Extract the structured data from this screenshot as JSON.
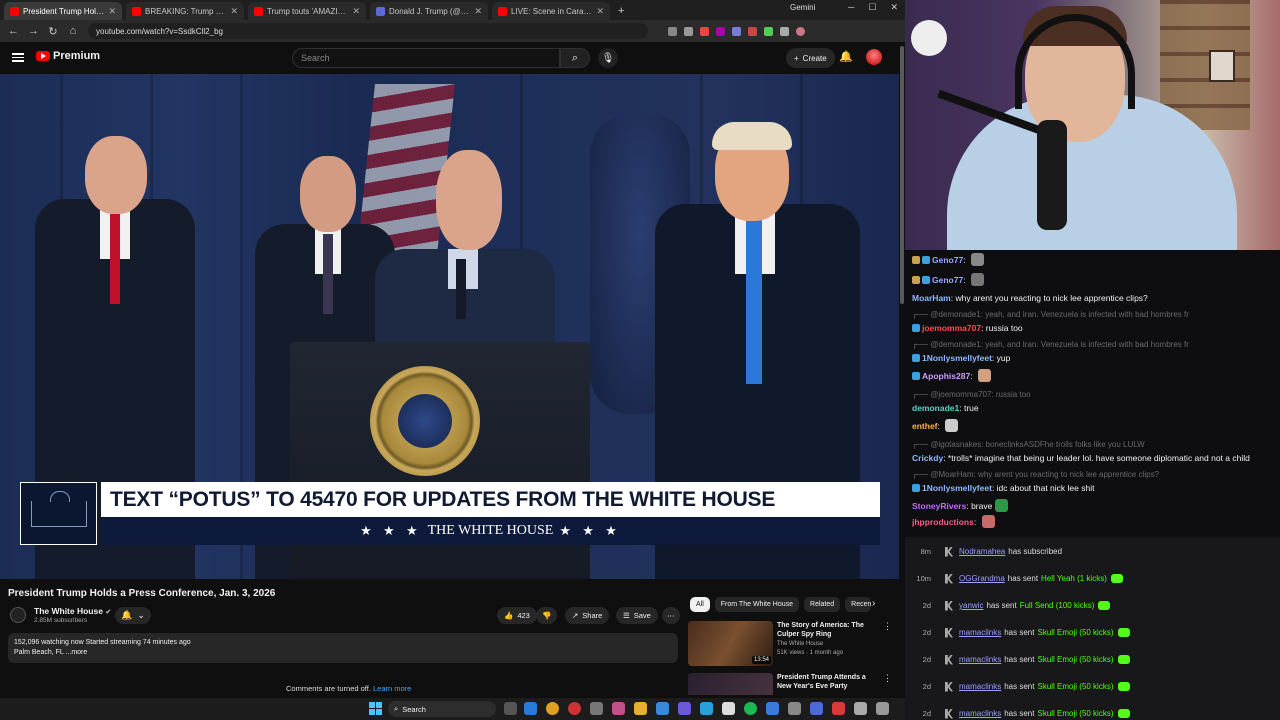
{
  "browser": {
    "tabs": [
      {
        "title": "President Trump Holds a Pr",
        "color": "#ff0000",
        "active": true
      },
      {
        "title": "BREAKING: Trump announce",
        "color": "#ff0000",
        "active": false
      },
      {
        "title": "Trump touts 'AMAZING' captur",
        "color": "#ff0000",
        "active": false
      },
      {
        "title": "Donald J. Trump (@realDon",
        "color": "#5a6bd8",
        "active": false
      },
      {
        "title": "LIVE: Scene in Caracas after U",
        "color": "#ff0000",
        "active": false
      }
    ],
    "pinned_tab": "Gemini",
    "url": "youtube.com/watch?v=SsdkCll2_bg"
  },
  "youtube": {
    "logo_text": "Premium",
    "search_placeholder": "Search",
    "create_label": "Create",
    "video": {
      "banner_text": "TEXT “POTUS” TO 45470 FOR UPDATES FROM THE WHITE HOUSE",
      "banner_stars_left": "★ ★ ★",
      "banner_sub": "THE WHITE HOUSE",
      "banner_stars_right": "★ ★ ★",
      "seal_text": "THE PRESIDENT OF THE UNITED STATES"
    },
    "title": "President Trump Holds a Press Conference, Jan. 3, 2026",
    "channel": {
      "name": "The White House",
      "subs": "2.85M subscribers"
    },
    "actions": {
      "likes": "423",
      "share": "Share",
      "save": "Save"
    },
    "description": {
      "line1": "152,096 watching now  Started streaming 74 minutes ago",
      "line2": "Palm Beach, FL ...more"
    },
    "comments_off": "Comments are turned off.",
    "learn_more": "Learn more",
    "chips": [
      "All",
      "From The White House",
      "Related",
      "Recently uploaded"
    ],
    "recommendations": [
      {
        "title": "The Story of America: The Culper Spy Ring",
        "channel": "The White House",
        "meta": "51K views · 1 month ago",
        "duration": "13:54"
      },
      {
        "title": "President Trump Attends a New Year's Eve Party",
        "channel": "",
        "meta": "",
        "duration": ""
      }
    ]
  },
  "chat": {
    "messages": [
      {
        "user": "Geno77",
        "text": "",
        "user_color": "#9aa8ff",
        "emote": true,
        "badges": 2,
        "reply": ""
      },
      {
        "user": "Geno77",
        "text": "",
        "user_color": "#9aa8ff",
        "emote": true,
        "badges": 2,
        "reply": ""
      },
      {
        "user": "MoarHam",
        "text": "why arent you reacting to nick lee apprentice clips?",
        "user_color": "#8fb8ff",
        "emote": false,
        "badges": 0,
        "reply": ""
      },
      {
        "user": "joemomma707",
        "text": "russia too",
        "user_color": "#ff4d4d",
        "emote": false,
        "badges": 1,
        "reply": "@demonade1: yeah, and Iran. Venezuela is infected with bad hombres fr"
      },
      {
        "user": "1Nonlysmellyfeet",
        "text": "yup",
        "user_color": "#8fb8ff",
        "emote": false,
        "badges": 1,
        "reply": "@demonade1: yeah, and Iran. Venezuela is infected with bad hombres fr"
      },
      {
        "user": "Apophis287",
        "text": "",
        "user_color": "#c9a0ff",
        "emote": true,
        "badges": 1,
        "reply": ""
      },
      {
        "user": "demonade1",
        "text": "true",
        "user_color": "#5bd1c6",
        "emote": false,
        "badges": 0,
        "reply": "@joemomma707: russia too"
      },
      {
        "user": "enthef",
        "text": "",
        "user_color": "#ffb347",
        "emote": true,
        "badges": 0,
        "reply": ""
      },
      {
        "user": "Crickdy",
        "text": "*trolls* imagine that being ur leader lol. have someone diplomatic and not a child",
        "user_color": "#8fb8ff",
        "emote": false,
        "badges": 0,
        "reply": "@igotasnakes: boneclinksASDFhe trolls folks like you LULW"
      },
      {
        "user": "1Nonlysmellyfeet",
        "text": "idc about that nick lee shit",
        "user_color": "#8fb8ff",
        "emote": false,
        "badges": 1,
        "reply": "@MoarHam: why arent you reacting to nick lee apprentice clips?"
      },
      {
        "user": "StoneyRivers",
        "text": "brave",
        "user_color": "#c36bff",
        "emote": true,
        "badges": 0,
        "reply": ""
      },
      {
        "user": "jhpproductions",
        "text": "",
        "user_color": "#ff5c8a",
        "emote": true,
        "badges": 0,
        "reply": ""
      }
    ]
  },
  "events": [
    {
      "time": "8m",
      "user": "Nodramahea",
      "action": "has subscribed",
      "item": ""
    },
    {
      "time": "10m",
      "user": "OGGrandma",
      "action": "has sent",
      "item": "Hell Yeah (1 kicks)"
    },
    {
      "time": "2d",
      "user": "yanwic",
      "action": "has sent",
      "item": "Full Send (100 kicks)"
    },
    {
      "time": "2d",
      "user": "mamaclinks",
      "action": "has sent",
      "item": "Skull Emoji (50 kicks)"
    },
    {
      "time": "2d",
      "user": "mamaclinks",
      "action": "has sent",
      "item": "Skull Emoji (50 kicks)"
    },
    {
      "time": "2d",
      "user": "mamaclinks",
      "action": "has sent",
      "item": "Skull Emoji (50 kicks)"
    },
    {
      "time": "2d",
      "user": "mamaclinks",
      "action": "has sent",
      "item": "Skull Emoji (50 kicks)"
    }
  ],
  "taskbar": {
    "search_label": "Search"
  },
  "colors": {
    "youtube_red": "#ff0000",
    "kick_green": "#53fc18",
    "link_blue": "#3ea6ff"
  }
}
